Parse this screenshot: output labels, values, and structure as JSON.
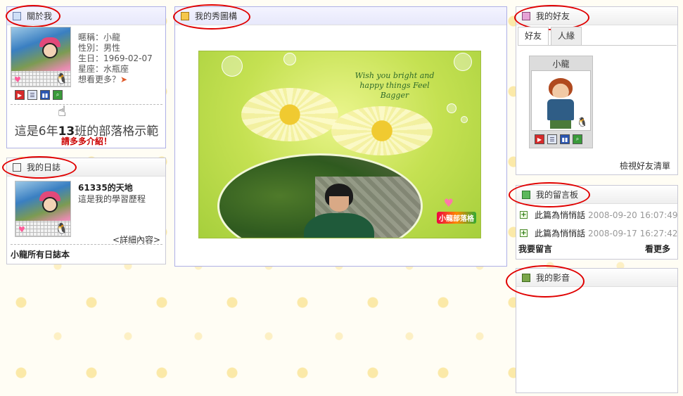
{
  "about": {
    "title": "關於我",
    "nickname": "暱稱：小龍",
    "gender": "性別：男性",
    "birthday": "生日：1969-02-07",
    "zodiac": "星座：水瓶座",
    "see_more": "想看更多？",
    "motto_prefix": "這是6年",
    "motto_class": "13",
    "motto_suffix": "班的部落格示範",
    "intro": "請多多介紹！"
  },
  "diary": {
    "title": "我的日誌",
    "blog_title": "61335的天地",
    "blog_subtitle": "這是我的學習歷程",
    "detail_link": "<詳細內容>",
    "all_diaries": "小龍所有日誌本"
  },
  "showcase": {
    "title": "我的秀圖構",
    "photo_text": "Wish you bright and happy things Feel Bagger",
    "stamp_text": "小龍部落格"
  },
  "friends": {
    "title": "我的好友",
    "tabs": [
      "好友",
      "人緣"
    ],
    "friend_name": "小龍",
    "view_all": "檢視好友清單"
  },
  "guestbook": {
    "title": "我的留言板",
    "entries": [
      {
        "text": "此篇為悄悄話",
        "date": "2008-09-20 16:07:49"
      },
      {
        "text": "此篇為悄悄話",
        "date": "2008-09-17 16:27:42"
      }
    ],
    "leave_message": "我要留言",
    "see_more": "看更多"
  },
  "media": {
    "title": "我的影音"
  },
  "icons": [
    "profile-icon",
    "diary-icon",
    "showcase-icon",
    "friend-icon",
    "guestbook-icon",
    "media-icon",
    "video-icon",
    "list-icon",
    "film-icon",
    "search-icon",
    "hand-cursor-icon"
  ],
  "colors": {
    "accent_red": "#e00000",
    "intro_red": "#cc0000",
    "panel_border_blue": "#aeb0e6",
    "background": "#fffdf4"
  }
}
